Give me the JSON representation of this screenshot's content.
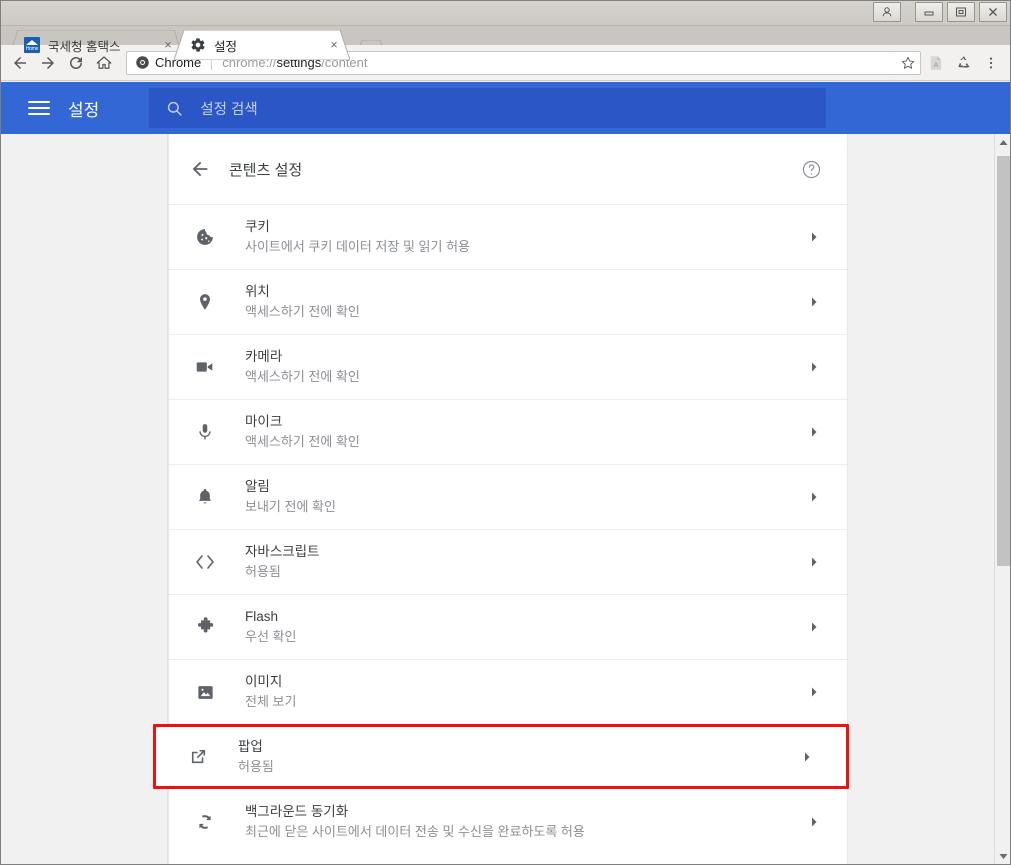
{
  "window": {
    "controls": [
      {
        "name": "user-account",
        "glyph": "person"
      },
      {
        "name": "minimize",
        "glyph": "minimize"
      },
      {
        "name": "maximize",
        "glyph": "maximize"
      },
      {
        "name": "close",
        "glyph": "close"
      }
    ]
  },
  "tabs": [
    {
      "title": "국세청 홈택스",
      "favicon": "home-favicon",
      "active": false,
      "close_label": "×"
    },
    {
      "title": "설정",
      "favicon": "gear-icon",
      "active": true,
      "close_label": "×"
    }
  ],
  "toolbar": {
    "back_label": "back-arrow-icon",
    "forward_label": "forward-arrow-icon",
    "reload_label": "reload-icon",
    "home_label": "home-icon",
    "omnibox": {
      "chip_label": "Chrome",
      "url_prefix": "chrome://",
      "url_strong": "settings",
      "url_suffix": "/content",
      "full_url": "chrome://settings/content"
    },
    "star_label": "bookmark-star-icon",
    "extensions": [
      {
        "name": "pdf-extension-icon"
      },
      {
        "name": "recycle-extension-icon"
      }
    ],
    "menu_label": "three-dot-menu-icon"
  },
  "settings_header": {
    "menu_label": "hamburger-menu-icon",
    "title": "설정",
    "search_placeholder": "설정 검색",
    "search_value": "",
    "accent_color": "#3367d6",
    "search_bg_color": "#2a56c6"
  },
  "content": {
    "back_label": "back-arrow-icon",
    "title": "콘텐츠 설정",
    "help_label": "help-circle-icon",
    "rows": [
      {
        "icon": "cookie-icon",
        "title": "쿠키",
        "sub": "사이트에서 쿠키 데이터 저장 및 읽기 허용",
        "highlighted": false
      },
      {
        "icon": "location-pin-icon",
        "title": "위치",
        "sub": "액세스하기 전에 확인",
        "highlighted": false
      },
      {
        "icon": "camera-icon",
        "title": "카메라",
        "sub": "액세스하기 전에 확인",
        "highlighted": false
      },
      {
        "icon": "microphone-icon",
        "title": "마이크",
        "sub": "액세스하기 전에 확인",
        "highlighted": false
      },
      {
        "icon": "bell-icon",
        "title": "알림",
        "sub": "보내기 전에 확인",
        "highlighted": false
      },
      {
        "icon": "code-brackets-icon",
        "title": "자바스크립트",
        "sub": "허용됨",
        "highlighted": false
      },
      {
        "icon": "puzzle-piece-icon",
        "title": "Flash",
        "sub": "우선 확인",
        "highlighted": false
      },
      {
        "icon": "image-icon",
        "title": "이미지",
        "sub": "전체 보기",
        "highlighted": false
      },
      {
        "icon": "external-link-icon",
        "title": "팝업",
        "sub": "허용됨",
        "highlighted": true
      },
      {
        "icon": "sync-icon",
        "title": "백그라운드 동기화",
        "sub": "최근에 닫은 사이트에서 데이터 전송 및 수신을 완료하도록 허용",
        "highlighted": false
      }
    ],
    "highlight_color": "#ef1010"
  },
  "scrollbar": {
    "up_label": "scroll-up-arrow",
    "down_label": "scroll-down-arrow"
  }
}
